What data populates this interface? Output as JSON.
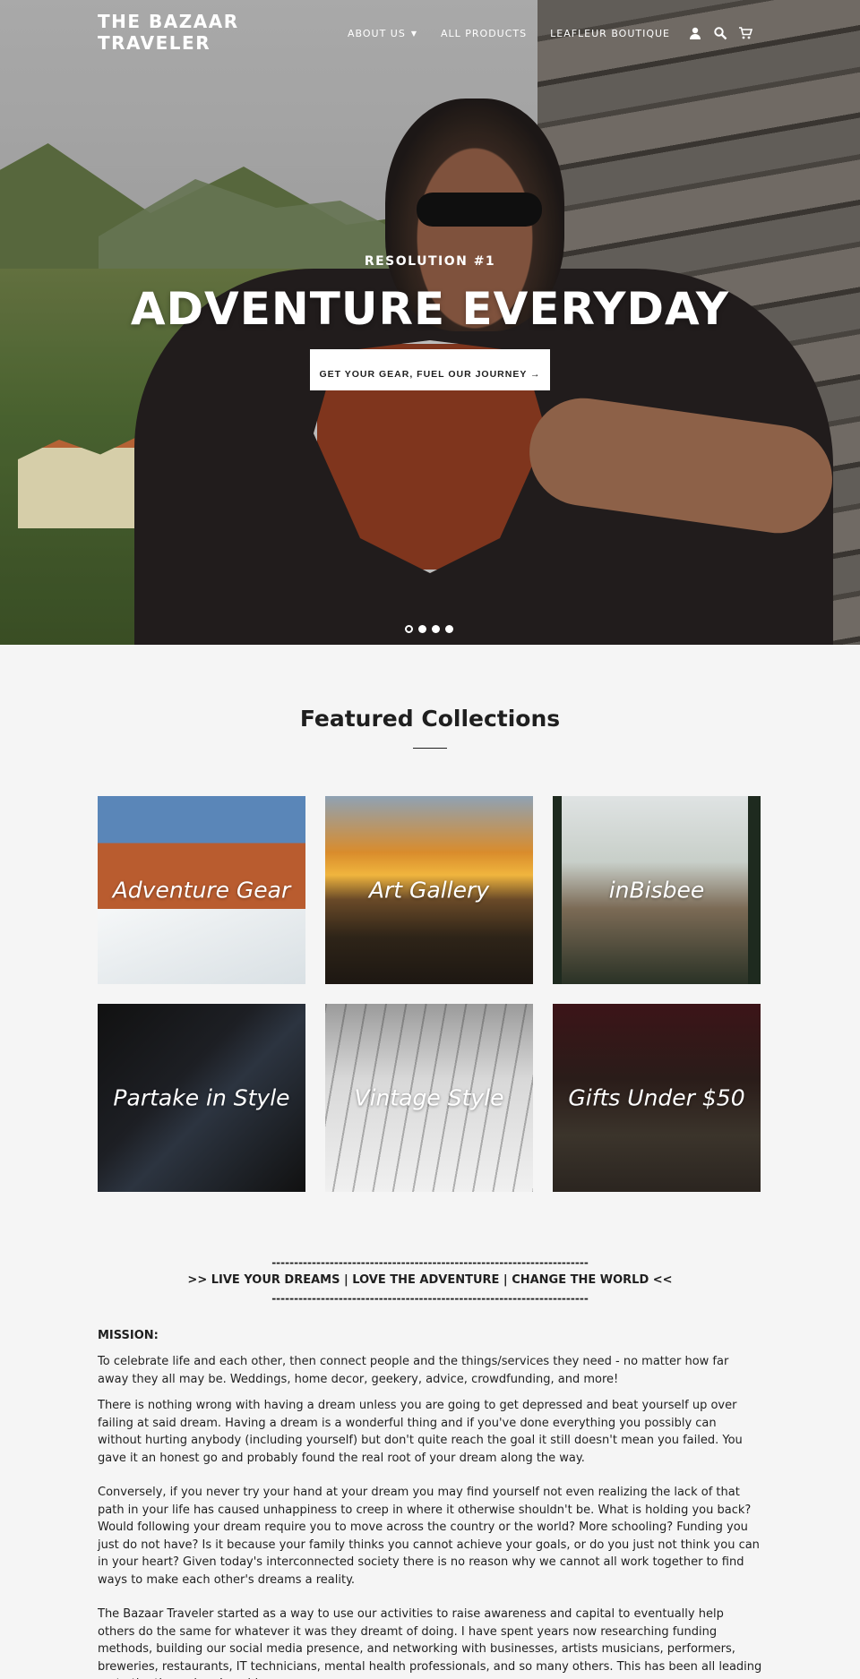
{
  "site": {
    "title": "THE BAZAAR TRAVELER"
  },
  "nav": {
    "items": [
      {
        "label": "ABOUT US",
        "has_dropdown": true
      },
      {
        "label": "ALL PRODUCTS"
      },
      {
        "label": "LEAFLEUR BOUTIQUE"
      }
    ],
    "icons": [
      "user-icon",
      "search-icon",
      "cart-icon"
    ]
  },
  "hero": {
    "subheading": "RESOLUTION #1",
    "heading": "ADVENTURE EVERYDAY",
    "button_label": "GET YOUR GEAR, FUEL OUR JOURNEY →",
    "slides": 4,
    "active_slide": 1
  },
  "featured": {
    "title": "Featured Collections",
    "collections": [
      {
        "label": "Adventure Gear"
      },
      {
        "label": "Art Gallery"
      },
      {
        "label": "inBisbee"
      },
      {
        "label": "Partake in Style"
      },
      {
        "label": "Vintage Style"
      },
      {
        "label": "Gifts Under $50"
      }
    ]
  },
  "about": {
    "divider": "-----------------------------------------------------------------------",
    "motto": ">> LIVE YOUR DREAMS | LOVE THE ADVENTURE | CHANGE THE WORLD <<",
    "mission_label": "MISSION:",
    "paragraphs": [
      "To celebrate life and each other, then connect people and the things/services they need - no matter how far away they all may be. Weddings, home decor, geekery, advice, crowdfunding, and more!",
      "There is nothing wrong with having a dream unless you are going to get depressed and beat yourself up over failing at said dream. Having a dream is a wonderful thing and if you've done everything you possibly can without hurting anybody (including yourself) but don't quite reach the goal it still doesn't mean you failed. You gave it an honest go and probably found the real root of your dream along the way.",
      "Conversely, if you never try your hand at your dream you may find yourself not even realizing the lack of that path in your life has caused unhappiness to creep in where it otherwise shouldn't be. What is holding you back? Would following your dream require you to move across the country or the world? More schooling? Funding you just do not have? Is it because your family thinks you cannot achieve your goals, or do you just not think you can in your heart? Given today's interconnected society there is no reason why we cannot all work together to find ways to make each other's dreams a reality.",
      "The Bazaar Traveler started as a way to use our activities to raise awareness and capital to eventually help others do the same for whatever it was they dreamt of doing. I have spent years now researching funding methods, building our social media presence, and networking with businesses, artists musicians, performers, breweries, restaurants, IT technicians, mental health professionals, and so many others. This has been all leading up to the time when I could"
    ]
  }
}
